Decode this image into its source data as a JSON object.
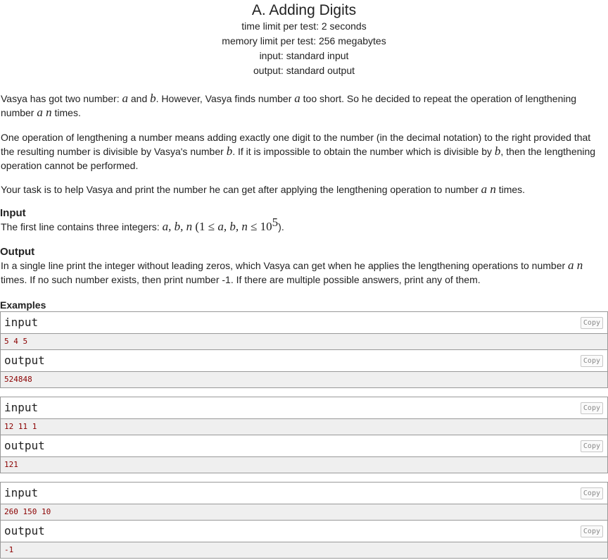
{
  "problem": {
    "title": "A. Adding Digits",
    "time_limit": "time limit per test: 2 seconds",
    "memory_limit": "memory limit per test: 256 megabytes",
    "input": "input: standard input",
    "output": "output: standard output"
  },
  "statement": {
    "p1_a": "Vasya has got two number: ",
    "p1_b": " and ",
    "p1_c": ". However, Vasya finds number ",
    "p1_d": " too short. So he decided to repeat the operation of lengthening number ",
    "p1_e": " times.",
    "p2_a": "One operation of lengthening a number means adding exactly one digit to the number (in the decimal notation) to the right provided that the resulting number is divisible by Vasya's number ",
    "p2_b": ". If it is impossible to obtain the number which is divisible by ",
    "p2_c": ", then the lengthening operation cannot be performed.",
    "p3_a": "Your task is to help Vasya and print the number he can get after applying the lengthening operation to number ",
    "p3_b": " times.",
    "var_a": "a",
    "var_b": "b",
    "var_an": "a n"
  },
  "input_spec": {
    "title": "Input",
    "text_a": "The first line contains three integers: ",
    "vars": "a, b, n",
    "constraint_open": " (1 ≤ ",
    "constraint_vars": "a, b, n",
    "constraint_mid": " ≤ 10",
    "constraint_exp": "5",
    "constraint_close": ")."
  },
  "output_spec": {
    "title": "Output",
    "text_a": "In a single line print the integer without leading zeros, which Vasya can get when he applies the lengthening operations to number ",
    "var": "a n",
    "text_b": " times. If no such number exists, then print number -1. If there are multiple possible answers, print any of them."
  },
  "examples": {
    "title": "Examples",
    "input_label": "input",
    "output_label": "output",
    "copy_label": "Copy",
    "items": [
      {
        "input": "5 4 5",
        "output": "524848"
      },
      {
        "input": "12 11 1",
        "output": "121"
      },
      {
        "input": "260 150 10",
        "output": "-1"
      }
    ]
  }
}
